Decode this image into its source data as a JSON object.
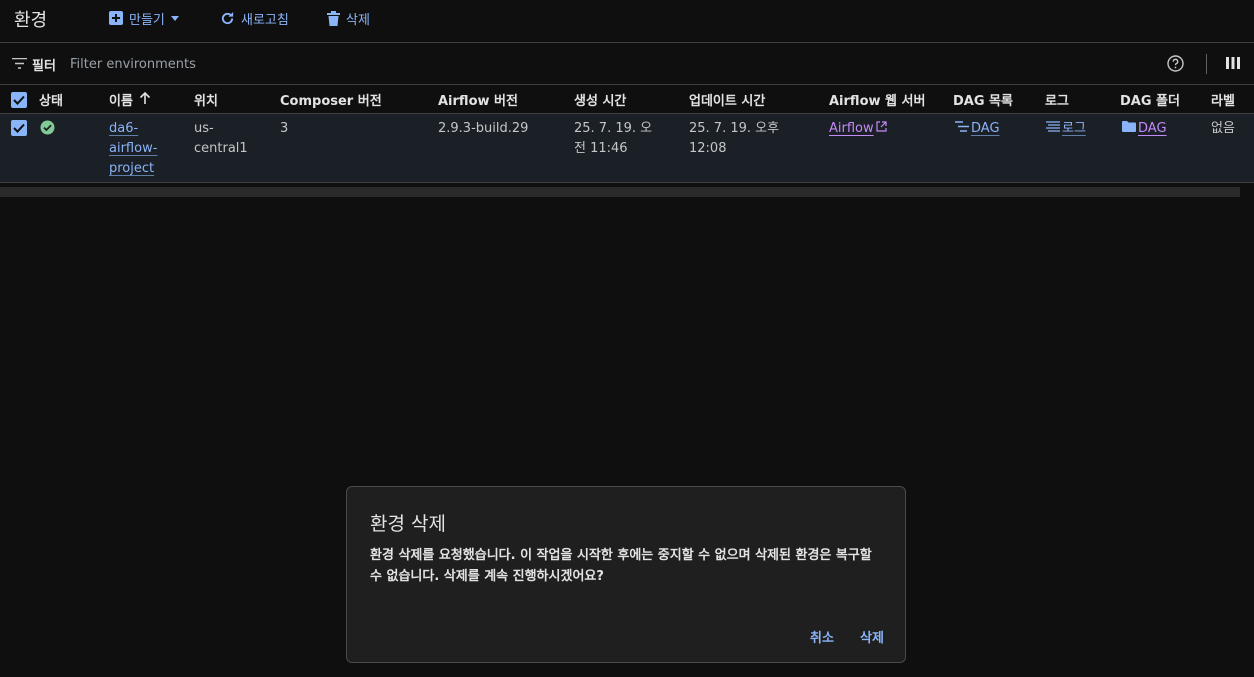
{
  "header": {
    "title": "환경",
    "create_label": "만들기",
    "refresh_label": "새로고침",
    "delete_label": "삭제"
  },
  "filter": {
    "label": "필터",
    "placeholder": "Filter environments"
  },
  "table": {
    "columns": [
      "상태",
      "이름",
      "위치",
      "Composer 버전",
      "Airflow 버전",
      "생성 시간",
      "업데이트 시간",
      "Airflow 웹 서버",
      "DAG 목록",
      "로그",
      "DAG 폴더",
      "라벨"
    ],
    "rows": [
      {
        "status": "ok",
        "name": "da6-airflow-project",
        "name_parts": [
          "da6-",
          "airflow-",
          "project"
        ],
        "location": "us-central1",
        "location_parts": [
          "us-",
          "central1"
        ],
        "composer_version": "3",
        "airflow_version": "2.9.3-build.29",
        "created": "25. 7. 19. 오전 11:46",
        "updated": "25. 7. 19. 오후 12:08",
        "webserver": "Airflow",
        "dag_list": "DAG",
        "logs": "로그",
        "dag_folder": "DAG",
        "labels": "없음"
      }
    ]
  },
  "dialog": {
    "title": "환경 삭제",
    "body": "환경 삭제를 요청했습니다. 이 작업을 시작한 후에는 중지할 수 없으며 삭제된 환경은 복구할 수 없습니다. 삭제를 계속 진행하시겠어요?",
    "cancel_label": "취소",
    "delete_label": "삭제"
  },
  "colors": {
    "accent": "#8ab4f8",
    "success": "#81c995",
    "visited_link": "#c58af9",
    "background": "#0f0f0f",
    "dialog_bg": "#1f1f1f"
  }
}
